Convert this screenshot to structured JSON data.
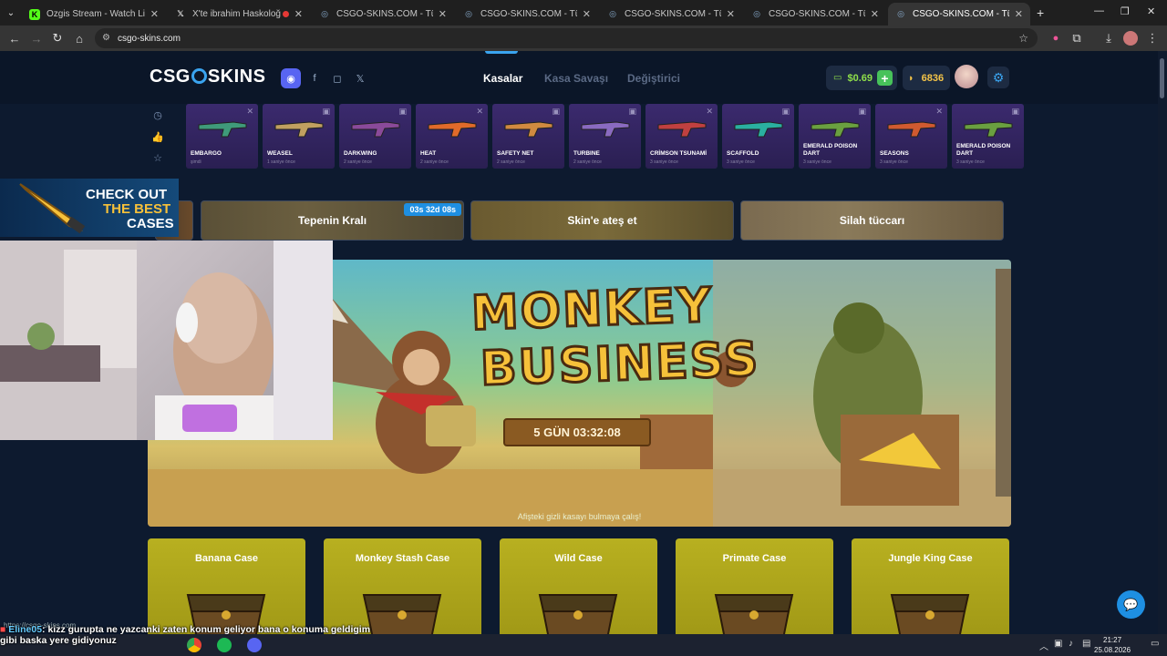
{
  "browser": {
    "tabs": [
      {
        "title": "Ozgis Stream - Watch Live on K",
        "favicon": "kick-icon",
        "active": false
      },
      {
        "title": "X'te ibrahim Haskoloğlu: \"",
        "favicon": "x-icon",
        "active": false
      },
      {
        "title": "CSGO-SKINS.COM - Türkiye'nin",
        "favicon": "site-icon",
        "active": false
      },
      {
        "title": "CSGO-SKINS.COM - Türkiye'nin",
        "favicon": "site-icon",
        "active": false
      },
      {
        "title": "CSGO-SKINS.COM - Türkiye'nin",
        "favicon": "site-icon",
        "active": false
      },
      {
        "title": "CSGO-SKINS.COM - Türkiye'nin",
        "favicon": "site-icon",
        "active": false
      },
      {
        "title": "CSGO-SKINS.COM - Türkiye'nin",
        "favicon": "site-icon",
        "active": true
      }
    ],
    "new_tab": "+",
    "url": "csgo-skins.com",
    "status_url": "https://csgo-skins.com"
  },
  "site": {
    "logo": {
      "left": "CSG",
      "right": "SKINS"
    },
    "nav": [
      {
        "label": "Kasalar",
        "active": true
      },
      {
        "label": "Kasa Savaşı",
        "active": false
      },
      {
        "label": "Değiştirici",
        "active": false
      }
    ],
    "balance": "$0.69",
    "coins": "6836",
    "colors": {
      "accent": "#3aa4f0",
      "balance": "#8fe04a",
      "coins": "#f4c448",
      "drop_bg": "#2e2259",
      "case_bg": "#aea51b"
    },
    "drops": [
      {
        "name": "EMBARGO",
        "time": "şimdi"
      },
      {
        "name": "WEASEL",
        "time": "1 saniye önce"
      },
      {
        "name": "DARKWING",
        "time": "2 saniye önce"
      },
      {
        "name": "HEAT",
        "time": "2 saniye önce"
      },
      {
        "name": "SAFETY NET",
        "time": "2 saniye önce"
      },
      {
        "name": "TURBINE",
        "time": "2 saniye önce"
      },
      {
        "name": "CRİMSON TSUNAMİ",
        "time": "3 saniye önce"
      },
      {
        "name": "SCAFFOLD",
        "time": "3 saniye önce"
      },
      {
        "name": "EMERALD POISON DART",
        "time": "3 saniye önce"
      },
      {
        "name": "SEASONS",
        "time": "3 saniye önce"
      },
      {
        "name": "EMERALD POISON DART",
        "time": "3 saniye önce"
      }
    ],
    "promos": [
      {
        "label": "Tepenin Kralı",
        "timer": "03s 32d 08s"
      },
      {
        "label": "Skin'e ateş et"
      },
      {
        "label": "Silah tüccarı"
      }
    ],
    "banner": {
      "title_line1": "MONKEY",
      "title_line2": "BUSINESS",
      "countdown": "5 GÜN  03:32:08",
      "caption": "Afişteki gizli kasayı bulmaya çalış!"
    },
    "cases": [
      {
        "name": "Banana Case"
      },
      {
        "name": "Monkey Stash Case"
      },
      {
        "name": "Wild Case"
      },
      {
        "name": "Primate Case"
      },
      {
        "name": "Jungle King Case"
      }
    ]
  },
  "stream_overlay": {
    "checkout": {
      "line1": "CHECK OUT",
      "line2": "THE BEST",
      "line3": "CASES"
    },
    "chat_user": "Eline05",
    "chat_message": ": kizz gurupta ne yazcanki zaten konum geliyor bana o konuma geldigim gibi baska yere gidiyonuz"
  },
  "taskbar": {
    "time": "21:27",
    "date": "25.08.2026"
  }
}
